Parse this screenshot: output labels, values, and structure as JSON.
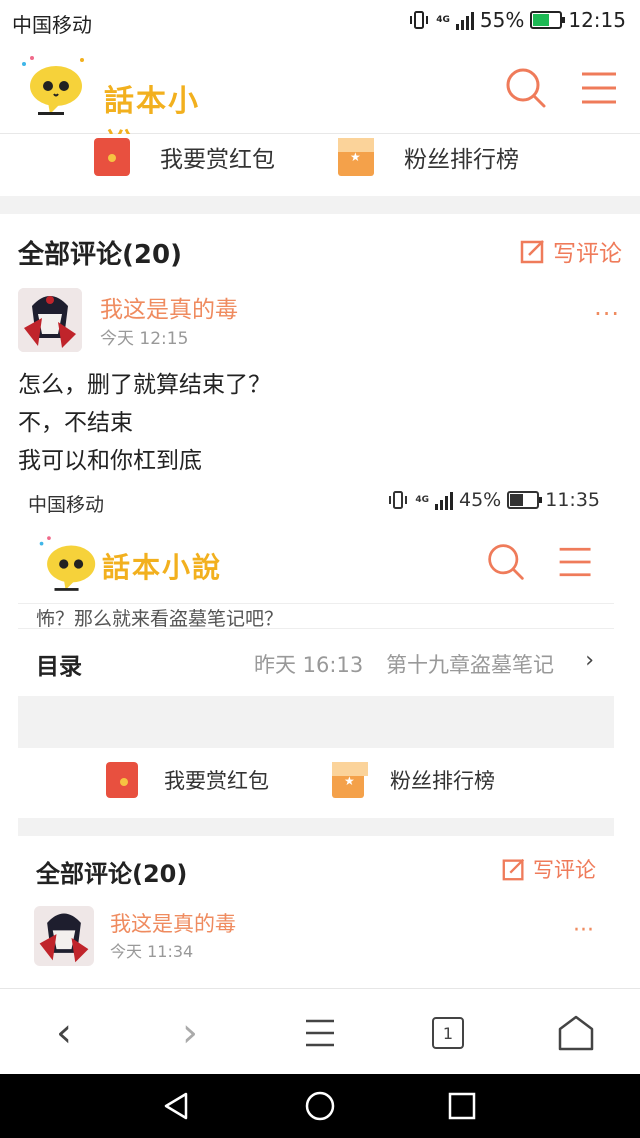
{
  "status": {
    "carrier": "中国移动",
    "network": "4G",
    "battery": "55%",
    "time": "12:15"
  },
  "app": {
    "logo_text": "話本小說",
    "search_icon": "search-icon",
    "menu_icon": "menu-icon"
  },
  "rewards": {
    "red_packet": "我要赏红包",
    "fan_rank": "粉丝排行榜"
  },
  "comments": {
    "title": "全部评论(20)",
    "write": "写评论",
    "items": [
      {
        "user": "我这是真的毒",
        "time": "今天 12:15",
        "more": "···",
        "lines": [
          "怎么，删了就算结束了？",
          "不，不结束",
          "我可以和你杠到底"
        ]
      }
    ]
  },
  "embedded": {
    "status": {
      "carrier": "中国移动",
      "network": "4G",
      "battery": "45%",
      "time": "11:35"
    },
    "logo_text": "話本小說",
    "intro_snippet": "怖？那么就来看盗墓笔记吧？",
    "toc": {
      "label": "目录",
      "date": "昨天 16:13",
      "chapter": "第十九章盗墓笔记",
      "chevron": "›"
    },
    "rewards": {
      "red_packet": "我要赏红包",
      "fan_rank": "粉丝排行榜"
    },
    "comments": {
      "title": "全部评论(20)",
      "write": "写评论",
      "user": "我这是真的毒",
      "time": "今天 11:34",
      "more": "···"
    }
  },
  "bottom_nav": {
    "back": "‹",
    "forward": "›",
    "tabs_count": "1"
  },
  "colors": {
    "accent": "#ef7b5a",
    "logo_yellow": "#f2b01e",
    "red_packet": "#e8503f",
    "fan_rank": "#f4a14a"
  }
}
